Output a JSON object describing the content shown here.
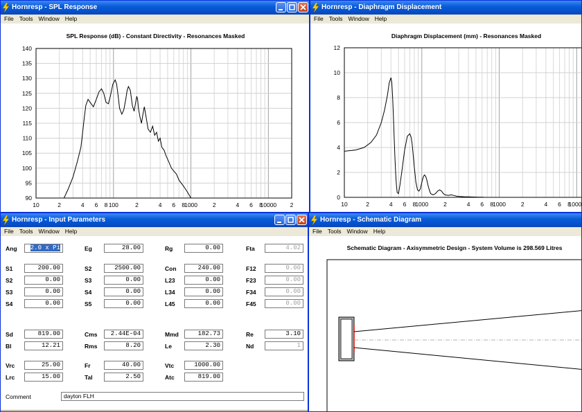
{
  "colors": {
    "title_bar": "#0a5cd8",
    "border": "#0831d9",
    "menu": "#ece9d8",
    "selection": "#316ac5"
  },
  "menus": {
    "spl": [
      "File",
      "Tools",
      "Window",
      "Help"
    ],
    "disp": [
      "File",
      "Tools",
      "Window",
      "Help"
    ],
    "inp": [
      "File",
      "Tools",
      "Window",
      "Help"
    ],
    "sch": [
      "File",
      "Tools",
      "Window",
      "Help"
    ]
  },
  "windows": {
    "spl": {
      "title": "Hornresp - SPL Response",
      "chart_title": "SPL Response (dB) - Constant Directivity - Resonances Masked"
    },
    "disp": {
      "title": "Hornresp - Diaphragm Displacement",
      "chart_title": "Diaphragm Displacement (mm) - Resonances Masked"
    },
    "inp": {
      "title": "Hornresp - Input Parameters"
    },
    "sch": {
      "title": "Hornresp - Schematic Diagram",
      "chart_title": "Schematic Diagram - Axisymmetric Design - System Volume is 298.569 Litres"
    }
  },
  "params": {
    "Ang": "2.0 x Pi",
    "Eg": "28.00",
    "Rg": "0.00",
    "Fta": "4.02",
    "S1": "200.00",
    "S2": "2500.00",
    "Con": "240.00",
    "F12": "0.00",
    "S2b": "0.00",
    "S3": "0.00",
    "L23": "0.00",
    "F23": "0.00",
    "S3b": "0.00",
    "S4": "0.00",
    "L34": "0.00",
    "F34": "0.00",
    "S4b": "0.00",
    "S5": "0.00",
    "L45": "0.00",
    "F45": "0.00",
    "Sd": "819.00",
    "Cms": "2.44E-04",
    "Mmd": "182.73",
    "Re": "3.10",
    "Bl": "12.21",
    "Rms": "8.20",
    "Le": "2.30",
    "Nd": "1",
    "Vrc": "25.00",
    "Fr": "40.00",
    "Vtc": "1000.00",
    "Lrc": "15.00",
    "Tal": "2.50",
    "Atc": "819.00",
    "Comment": "dayton FLH"
  },
  "labels": {
    "Ang": "Ang",
    "Eg": "Eg",
    "Rg": "Rg",
    "Fta": "Fta",
    "S1": "S1",
    "S2": "S2",
    "Con": "Con",
    "F12": "F12",
    "S2b": "S2",
    "S3": "S3",
    "L23": "L23",
    "F23": "F23",
    "S3b": "S3",
    "S4": "S4",
    "L34": "L34",
    "F34": "F34",
    "S4b": "S4",
    "S5": "S5",
    "L45": "L45",
    "F45": "F45",
    "Sd": "Sd",
    "Cms": "Cms",
    "Mmd": "Mmd",
    "Re": "Re",
    "Bl": "Bl",
    "Rms": "Rms",
    "Le": "Le",
    "Nd": "Nd",
    "Vrc": "Vrc",
    "Fr": "Fr",
    "Vtc": "Vtc",
    "Lrc": "Lrc",
    "Tal": "Tal",
    "Atc": "Atc",
    "Comment": "Comment"
  },
  "chart_data": [
    {
      "type": "line",
      "title": "SPL Response (dB) - Constant Directivity - Resonances Masked",
      "xscale": "log",
      "xlim": [
        10,
        20000
      ],
      "ylim": [
        90,
        140
      ],
      "x_tick_labels": [
        "10",
        "2",
        "4",
        "6",
        "8",
        "100",
        "2",
        "4",
        "6",
        "8",
        "1000",
        "2",
        "4",
        "6",
        "8",
        "10000",
        "2"
      ],
      "y_ticks": [
        90,
        95,
        100,
        105,
        110,
        115,
        120,
        125,
        130,
        135,
        140
      ],
      "grid": true,
      "x": [
        23,
        26,
        30,
        34,
        38,
        40,
        42,
        44,
        47,
        50,
        55,
        60,
        65,
        70,
        75,
        80,
        86,
        92,
        98,
        105,
        110,
        115,
        120,
        128,
        136,
        144,
        150,
        156,
        165,
        175,
        185,
        195,
        200,
        205,
        210,
        220,
        230,
        240,
        250,
        260,
        270,
        280,
        300,
        320,
        340,
        360,
        380,
        400,
        420,
        450,
        480,
        520,
        560,
        600,
        650,
        700,
        750,
        800,
        850,
        900,
        950,
        1000,
        1050,
        1100,
        1150,
        1200
      ],
      "y": [
        90,
        93,
        97,
        102,
        107,
        112,
        117,
        121,
        123,
        122,
        120.5,
        123,
        125.5,
        126.5,
        125,
        122,
        121.5,
        124.5,
        128,
        129.5,
        128,
        124,
        120,
        118,
        119.5,
        123,
        126,
        127.3,
        126,
        121,
        119,
        122.5,
        124,
        123,
        120,
        117,
        115,
        118,
        120.5,
        118,
        115.5,
        113,
        112,
        114,
        111,
        112,
        109,
        110,
        107,
        106,
        104,
        102,
        100,
        99,
        98,
        96,
        95,
        94,
        93,
        92,
        91,
        90,
        89,
        88,
        87,
        86
      ],
      "line_color": "#000000"
    },
    {
      "type": "line",
      "title": "Diaphragm Displacement (mm) - Resonances Masked",
      "xscale": "log",
      "xlim": [
        10,
        20000
      ],
      "ylim": [
        0,
        12
      ],
      "x_tick_labels": [
        "10",
        "2",
        "4",
        "6",
        "8",
        "1000",
        "2",
        "4",
        "6",
        "8",
        "1000",
        "2",
        "4",
        "6",
        "8",
        "10000",
        "2"
      ],
      "y_ticks": [
        0,
        2,
        4,
        6,
        8,
        10,
        12
      ],
      "grid": true,
      "x": [
        10,
        14,
        18,
        22,
        26,
        30,
        33,
        36,
        38,
        40,
        41,
        42,
        43,
        44,
        45,
        46,
        47,
        48,
        50,
        52,
        55,
        60,
        65,
        70,
        73,
        75,
        78,
        80,
        84,
        88,
        92,
        96,
        100,
        104,
        108,
        112,
        116,
        120,
        125,
        130,
        140,
        150,
        160,
        170,
        180,
        190,
        200,
        220,
        240,
        260,
        280,
        300,
        350,
        400,
        450,
        500,
        550,
        600,
        650,
        700
      ],
      "y": [
        3.7,
        3.8,
        4.0,
        4.4,
        5.0,
        6.0,
        7.0,
        8.2,
        9.2,
        9.6,
        9.2,
        8.0,
        6.5,
        4.8,
        3.2,
        1.9,
        1.0,
        0.4,
        0.3,
        0.9,
        2.0,
        3.8,
        4.9,
        5.1,
        4.8,
        4.3,
        3.2,
        2.4,
        1.2,
        0.6,
        0.5,
        0.7,
        1.2,
        1.6,
        1.8,
        1.7,
        1.4,
        1.0,
        0.6,
        0.3,
        0.2,
        0.3,
        0.5,
        0.6,
        0.5,
        0.3,
        0.2,
        0.15,
        0.2,
        0.15,
        0.1,
        0.08,
        0.05,
        0.04,
        0.03,
        0.02,
        0.01,
        0.01,
        0.0,
        0.0
      ],
      "line_color": "#000000"
    }
  ]
}
